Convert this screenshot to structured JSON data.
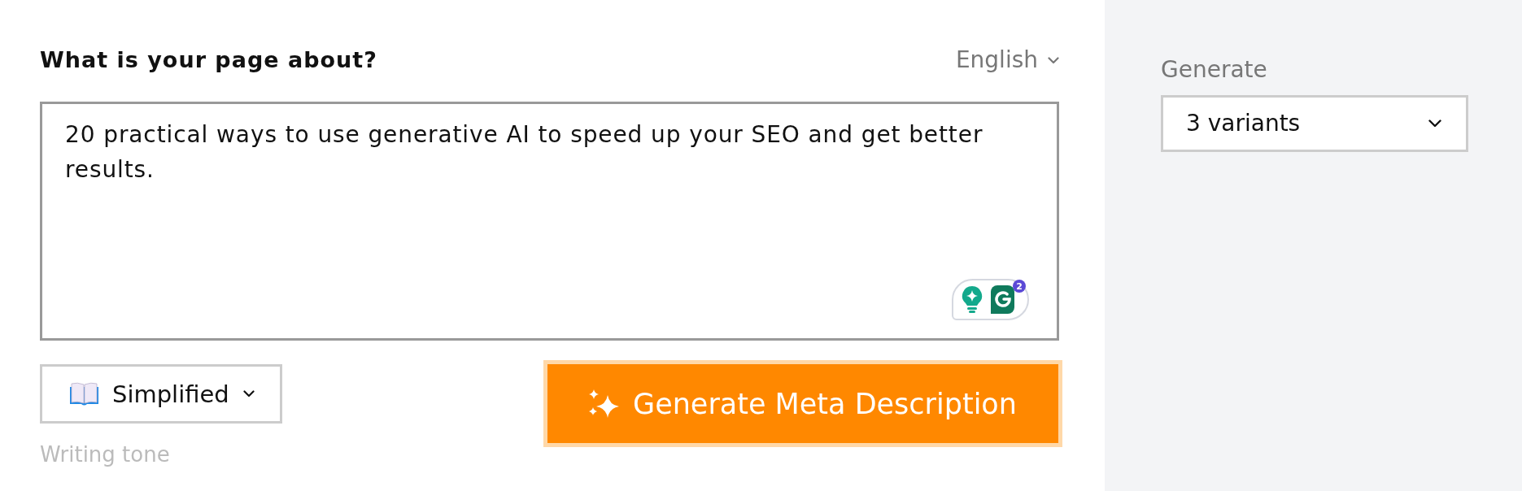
{
  "topic": {
    "label": "What is your page about?",
    "language": "English",
    "value": "20 practical ways to use generative AI to speed up your SEO and get better results."
  },
  "assistant_widget": {
    "badge": "2"
  },
  "tone": {
    "value": "Simplified",
    "caption": "Writing tone"
  },
  "generate_button": {
    "label": "Generate Meta Description"
  },
  "sidebar": {
    "label": "Generate",
    "value": "3 variants"
  }
}
